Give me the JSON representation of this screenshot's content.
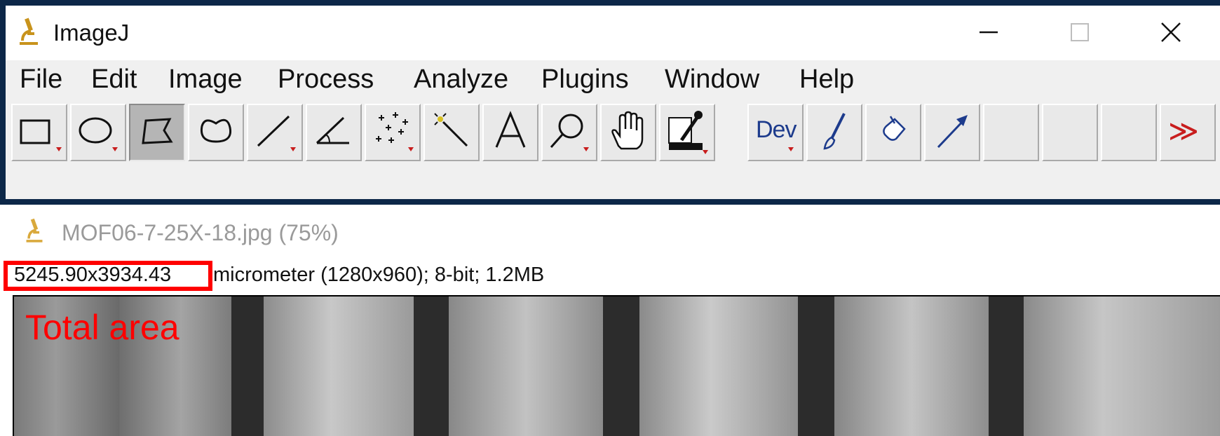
{
  "app": {
    "title": "ImageJ",
    "icon": "microscope-icon"
  },
  "window_controls": {
    "minimize": "minimize-icon",
    "maximize": "maximize-icon",
    "close": "close-icon"
  },
  "menu": [
    "File",
    "Edit",
    "Image",
    "Process",
    "Analyze",
    "Plugins",
    "Window",
    "Help"
  ],
  "toolbar": {
    "tools": [
      {
        "name": "rectangle-tool",
        "icon": "rectangle-icon",
        "has_dropdown": true
      },
      {
        "name": "oval-tool",
        "icon": "oval-icon",
        "has_dropdown": true
      },
      {
        "name": "polygon-tool",
        "icon": "polygon-icon",
        "selected": true
      },
      {
        "name": "freehand-tool",
        "icon": "freehand-icon"
      },
      {
        "name": "line-tool",
        "icon": "line-icon",
        "has_dropdown": true
      },
      {
        "name": "angle-tool",
        "icon": "angle-icon"
      },
      {
        "name": "multipoint-tool",
        "icon": "multipoint-icon",
        "has_dropdown": true
      },
      {
        "name": "wand-tool",
        "icon": "wand-icon"
      },
      {
        "name": "text-tool",
        "icon": "text-icon"
      },
      {
        "name": "zoom-tool",
        "icon": "magnifier-icon",
        "has_dropdown": true
      },
      {
        "name": "hand-tool",
        "icon": "hand-icon"
      },
      {
        "name": "color-picker-tool",
        "icon": "dropper-icon",
        "has_dropdown": true
      },
      {
        "name": "dev-tool",
        "label": "Dev",
        "has_dropdown": true
      },
      {
        "name": "brush-tool",
        "icon": "brush-icon"
      },
      {
        "name": "flood-fill-tool",
        "icon": "bucket-icon"
      },
      {
        "name": "arrow-tool",
        "icon": "arrow-icon"
      },
      {
        "name": "empty-slot-1"
      },
      {
        "name": "empty-slot-2"
      },
      {
        "name": "empty-slot-3"
      },
      {
        "name": "more-tools",
        "label": "≫"
      }
    ],
    "accent_color": "#1d3b8c"
  },
  "image_window": {
    "title": "MOF06-7-25X-18.jpg (75%)",
    "dimensions": "5245.90x3934.43",
    "info_rest": "micrometer (1280x960); 8-bit; 1.2MB",
    "annotation": "Total area",
    "annotation_color": "#ff0000"
  }
}
